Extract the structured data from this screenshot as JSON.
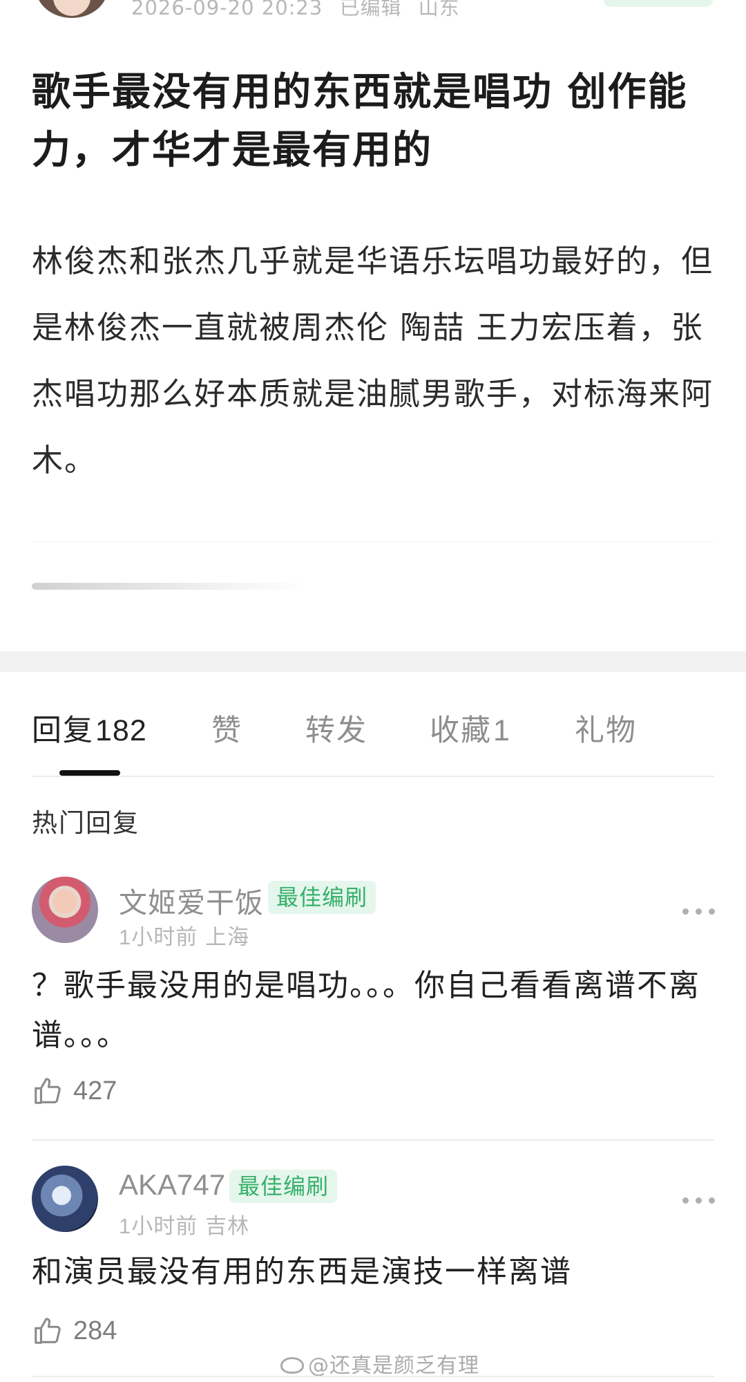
{
  "post": {
    "date": "2026-09-20 20:23",
    "edited_label": "已编辑",
    "location": "山东",
    "title": "歌手最没有用的东西就是唱功 创作能力，才华才是最有用的",
    "body": "林俊杰和张杰几乎就是华语乐坛唱功最好的，但是林俊杰一直就被周杰伦 陶喆 王力宏压着，张杰唱功那么好本质就是油腻男歌手，对标海来阿木。"
  },
  "tabs": [
    {
      "label": "回复",
      "count": "182"
    },
    {
      "label": "赞",
      "count": ""
    },
    {
      "label": "转发",
      "count": ""
    },
    {
      "label": "收藏",
      "count": "1"
    },
    {
      "label": "礼物",
      "count": ""
    }
  ],
  "section_heading": "热门回复",
  "replies": [
    {
      "username": "文姬爱干饭",
      "badge": "最佳编刷",
      "time": "1小时前",
      "location": "上海",
      "text": "？歌手最没用的是唱功。。。你自己看看离谱不离谱。。。",
      "likes": "427"
    },
    {
      "username": "AKA747",
      "badge": "最佳编刷",
      "time": "1小时前",
      "location": "吉林",
      "text": "和演员最没有用的东西是演技一样离谱",
      "likes": "284"
    }
  ],
  "watermark": "@还真是颜乏有理",
  "colors": {
    "badge_bg": "#e5f6ec",
    "badge_text": "#37b06a",
    "muted": "#8f8f8f"
  }
}
